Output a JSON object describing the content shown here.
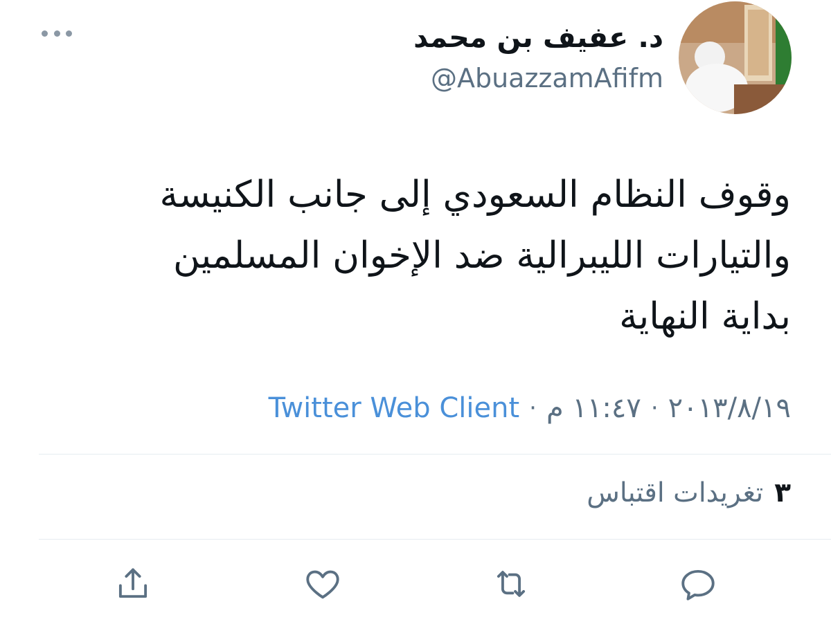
{
  "tweet": {
    "author": {
      "display_name": "د. عفيف بن محمد",
      "handle": "@AbuazzamAfifm"
    },
    "text_lines": [
      "وقوف النظام السعودي إلى جانب الكنيسة",
      "والتيارات الليبرالية ضد الإخوان المسلمين",
      "بداية النهاية"
    ],
    "date": "٢٠١٣/٨/١٩",
    "time": "١١:٤٧ م",
    "separator": "·",
    "client": "Twitter Web Client",
    "quote_count": "٣",
    "quote_label": "تغريدات اقتباس"
  },
  "icons": {
    "more": "more-dots-icon",
    "reply": "reply-icon",
    "retweet": "retweet-icon",
    "like": "heart-icon",
    "share": "share-icon"
  },
  "colors": {
    "text": "#0f1419",
    "secondary": "#5b7083",
    "link": "#4a90d9",
    "divider": "#e6ecf0"
  }
}
